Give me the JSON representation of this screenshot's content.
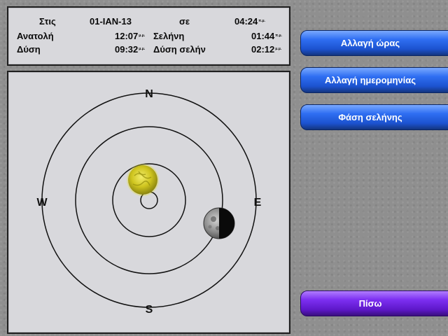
{
  "info": {
    "row1": {
      "at_label": "Στις",
      "date": "01-IAN-13",
      "se_label": "σε",
      "time": "04:24",
      "time_suffix": "π.μ."
    },
    "sunrise": {
      "label": "Ανατολή",
      "time": "12:07",
      "suffix": "μ.μ."
    },
    "moonrise": {
      "label": "Σελήνη",
      "time": "01:44",
      "suffix": "π.μ."
    },
    "sunset": {
      "label": "Δύση",
      "time": "09:32",
      "suffix": "μ.μ."
    },
    "moonset": {
      "label": "Δύση σελήν",
      "time": "02:12",
      "suffix": "μ.μ."
    }
  },
  "sky": {
    "north": "N",
    "south": "S",
    "west": "W",
    "east": "E",
    "sun_icon": "sun-icon",
    "moon_icon": "moon-icon",
    "sun_color": "#d9d12a",
    "moon_color": "#6a6a6a"
  },
  "buttons": {
    "change_time": "Αλλαγή ώρας",
    "change_date": "Αλλαγή ημερομηνίας",
    "moon_phase": "Φάση σελήνης",
    "back": "Πίσω"
  }
}
